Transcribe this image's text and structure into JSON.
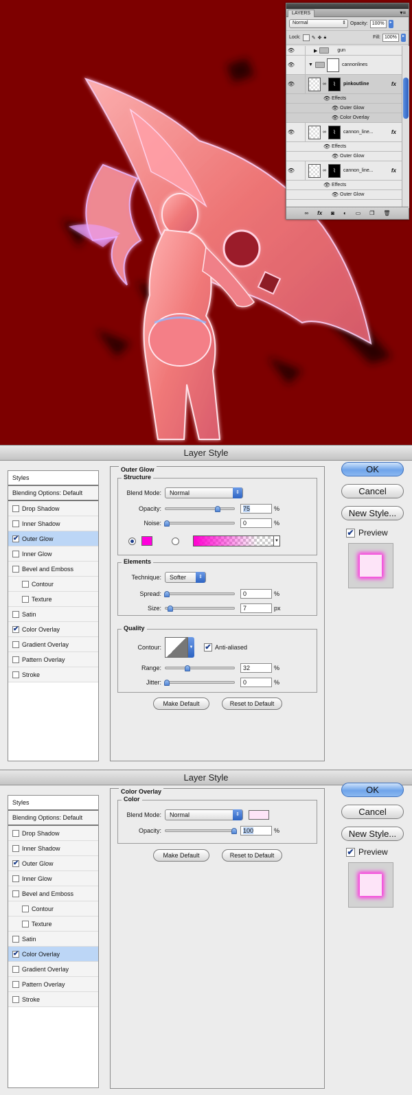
{
  "layers_panel": {
    "tab": "LAYERS",
    "blend_mode": "Normal",
    "opacity_label": "Opacity:",
    "opacity": "100%",
    "lock_label": "Lock:",
    "fill_label": "Fill:",
    "fill": "100%",
    "layers": [
      {
        "name": "gun",
        "kind": "group"
      },
      {
        "name": "cannonlines",
        "kind": "group"
      },
      {
        "name": "pinkoutline",
        "kind": "layer",
        "selected": true
      },
      {
        "name": "Effects",
        "kind": "effects"
      },
      {
        "name": "Outer Glow",
        "kind": "effect"
      },
      {
        "name": "Color Overlay",
        "kind": "effect"
      },
      {
        "name": "cannon_line...",
        "kind": "layer"
      },
      {
        "name": "Effects",
        "kind": "effects"
      },
      {
        "name": "Outer Glow",
        "kind": "effect"
      },
      {
        "name": "cannon_line...",
        "kind": "layer"
      },
      {
        "name": "Effects",
        "kind": "effects"
      },
      {
        "name": "Outer Glow",
        "kind": "effect"
      }
    ],
    "fx_label": "fx"
  },
  "styles_items": [
    "Drop Shadow",
    "Inner Shadow",
    "Outer Glow",
    "Inner Glow",
    "Bevel and Emboss",
    "Contour",
    "Texture",
    "Satin",
    "Color Overlay",
    "Gradient Overlay",
    "Pattern Overlay",
    "Stroke"
  ],
  "dialog_common": {
    "title": "Layer Style",
    "styles_header": "Styles",
    "blending_options": "Blending Options: Default",
    "ok": "OK",
    "cancel": "Cancel",
    "new_style": "New Style...",
    "preview": "Preview",
    "make_default": "Make Default",
    "reset_default": "Reset to Default",
    "check": "✔"
  },
  "outer_glow": {
    "title": "Outer Glow",
    "structure": "Structure",
    "blend_mode_label": "Blend Mode:",
    "blend_mode": "Normal",
    "opacity_label": "Opacity:",
    "opacity": "75",
    "noise_label": "Noise:",
    "noise": "0",
    "elements": "Elements",
    "technique_label": "Technique:",
    "technique": "Softer",
    "spread_label": "Spread:",
    "spread": "0",
    "size_label": "Size:",
    "size": "7",
    "quality": "Quality",
    "contour_label": "Contour:",
    "anti_aliased": "Anti-aliased",
    "range_label": "Range:",
    "range": "32",
    "jitter_label": "Jitter:",
    "jitter": "0",
    "pct": "%",
    "px": "px",
    "glow_color": "#ff00dd"
  },
  "color_overlay": {
    "title": "Color Overlay",
    "color_group": "Color",
    "blend_mode_label": "Blend Mode:",
    "blend_mode": "Normal",
    "opacity_label": "Opacity:",
    "opacity": "100",
    "pct": "%",
    "color": "#fde4f7"
  },
  "colors": {
    "canvas_bg": "#7d0000",
    "accent": "#5b8fe0",
    "glow": "#ff2ee0"
  }
}
